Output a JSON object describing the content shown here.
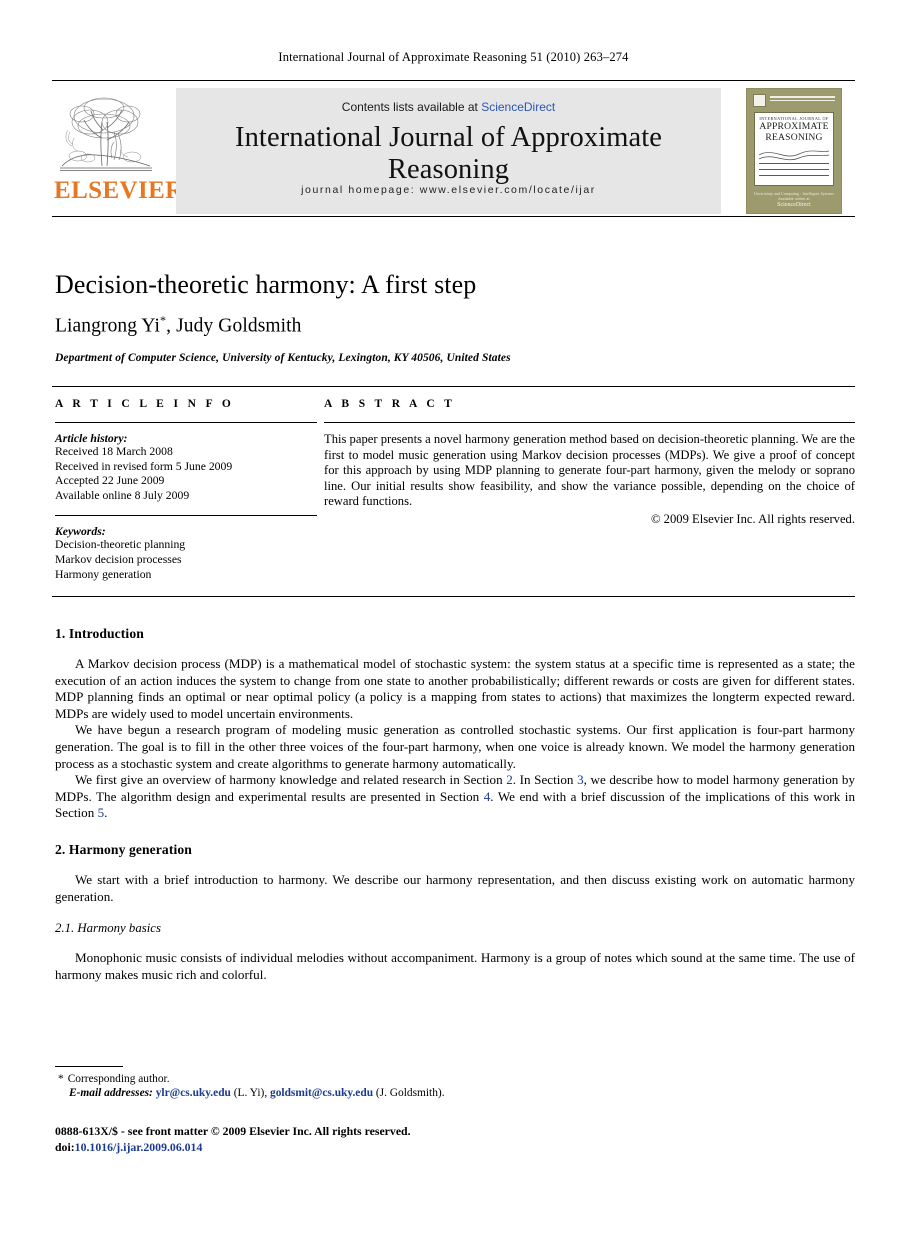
{
  "running_head": "International Journal of Approximate Reasoning 51 (2010) 263–274",
  "masthead": {
    "contents_prefix": "Contents lists available at ",
    "sciencedirect": "ScienceDirect",
    "journal_title": "International Journal of Approximate Reasoning",
    "homepage": "journal homepage: www.elsevier.com/locate/ijar",
    "publisher_wordmark": "ELSEVIER",
    "accent_orange": "#e87722",
    "link_blue": "#2b57b0",
    "banner_gray": "#e6e6e6"
  },
  "cover": {
    "kicker": "INTERNATIONAL JOURNAL OF",
    "title_line1": "APPROXIMATE",
    "title_line2": "REASONING",
    "tagline": "Uncertainty and Computing : Intelligent Systems",
    "sciencedirect_small": "Available online at",
    "sciencedirect_word": "ScienceDirect",
    "background": "#9b9b6d"
  },
  "article": {
    "title": "Decision-theoretic harmony: A first step",
    "authors": "Liangrong Yi",
    "author_marker": "*",
    "authors_rest": ", Judy Goldsmith",
    "affiliation": "Department of Computer Science, University of Kentucky, Lexington, KY 40506, United States"
  },
  "info": {
    "heading": "A R T I C L E   I N F O",
    "history_label": "Article history:",
    "history": [
      "Received 18 March 2008",
      "Received in revised form 5 June 2009",
      "Accepted 22 June 2009",
      "Available online 8 July 2009"
    ],
    "keywords_label": "Keywords:",
    "keywords": [
      "Decision-theoretic planning",
      "Markov decision processes",
      "Harmony generation"
    ]
  },
  "abstract": {
    "heading": "A B S T R A C T",
    "body": "This paper presents a novel harmony generation method based on decision-theoretic planning. We are the first to model music generation using Markov decision processes (MDPs). We give a proof of concept for this approach by using MDP planning to generate four-part harmony, given the melody or soprano line. Our initial results show feasibility, and show the variance possible, depending on the choice of reward functions.",
    "copyright": "© 2009 Elsevier Inc. All rights reserved."
  },
  "sections": {
    "intro_heading": "1. Introduction",
    "intro_p1": "A Markov decision process (MDP) is a mathematical model of stochastic system: the system status at a specific time is represented as a state; the execution of an action induces the system to change from one state to another probabilistically; different rewards or costs are given for different states. MDP planning finds an optimal or near optimal policy (a policy is a mapping from states to actions) that maximizes the longterm expected reward. MDPs are widely used to model uncertain environments.",
    "intro_p2": "We have begun a research program of modeling music generation as controlled stochastic systems. Our first application is four-part harmony generation. The goal is to fill in the other three voices of the four-part harmony, when one voice is already known. We model the harmony generation process as a stochastic system and create algorithms to generate harmony automatically.",
    "intro_p3_a": "We first give an overview of harmony knowledge and related research in Section ",
    "intro_p3_ref1": "2",
    "intro_p3_b": ". In Section ",
    "intro_p3_ref2": "3",
    "intro_p3_c": ", we describe how to model harmony generation by MDPs. The algorithm design and experimental results are presented in Section ",
    "intro_p3_ref3": "4",
    "intro_p3_d": ". We end with a brief discussion of the implications of this work in Section ",
    "intro_p3_ref4": "5",
    "intro_p3_e": ".",
    "harmony_heading": "2. Harmony generation",
    "harmony_p1": "We start with a brief introduction to harmony. We describe our harmony representation, and then discuss existing work on automatic harmony generation.",
    "basics_heading": "2.1. Harmony basics",
    "basics_p1": "Monophonic music consists of individual melodies without accompaniment. Harmony is a group of notes which sound at the same time. The use of harmony makes music rich and colorful."
  },
  "footnotes": {
    "star": "*",
    "corresponding": "Corresponding author.",
    "email_label": "E-mail addresses:",
    "email1": "ylr@cs.uky.edu",
    "email1_owner": " (L. Yi), ",
    "email2": "goldsmit@cs.uky.edu",
    "email2_owner": " (J. Goldsmith)."
  },
  "imprint": {
    "line1": "0888-613X/$ - see front matter © 2009 Elsevier Inc. All rights reserved.",
    "doi_label": "doi:",
    "doi_value": "10.1016/j.ijar.2009.06.014"
  }
}
